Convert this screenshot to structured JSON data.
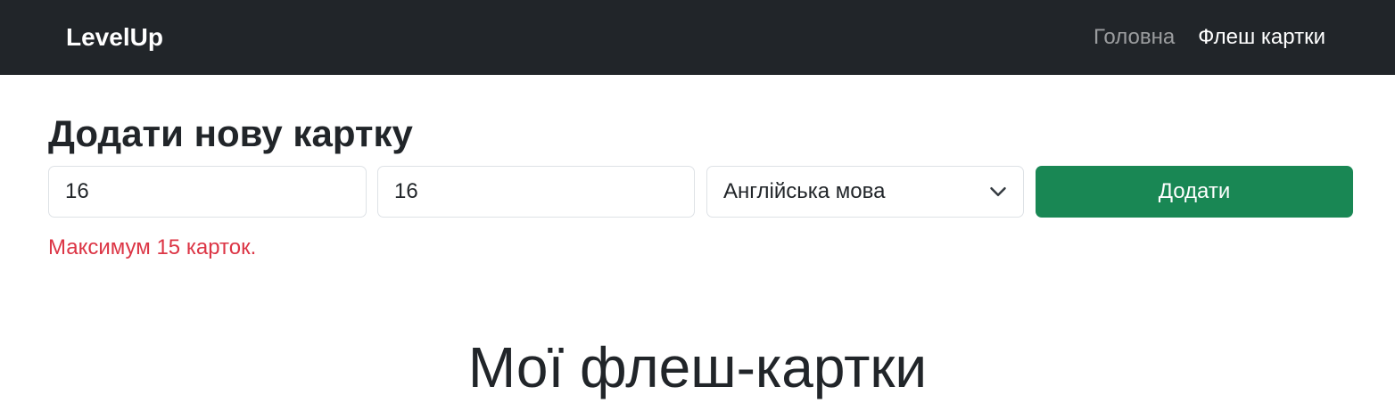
{
  "navbar": {
    "brand": "LevelUp",
    "links": [
      {
        "label": "Головна",
        "active": false
      },
      {
        "label": "Флеш картки",
        "active": true
      }
    ]
  },
  "form": {
    "title": "Додати нову картку",
    "front_value": "16",
    "back_value": "16",
    "language_selected": "Англійська мова",
    "submit_label": "Додати",
    "error_message": "Максимум 15 карток."
  },
  "section": {
    "title": "Мої флеш-картки"
  },
  "colors": {
    "navbar_bg": "#212529",
    "submit_bg": "#198754",
    "error": "#dc3545"
  }
}
